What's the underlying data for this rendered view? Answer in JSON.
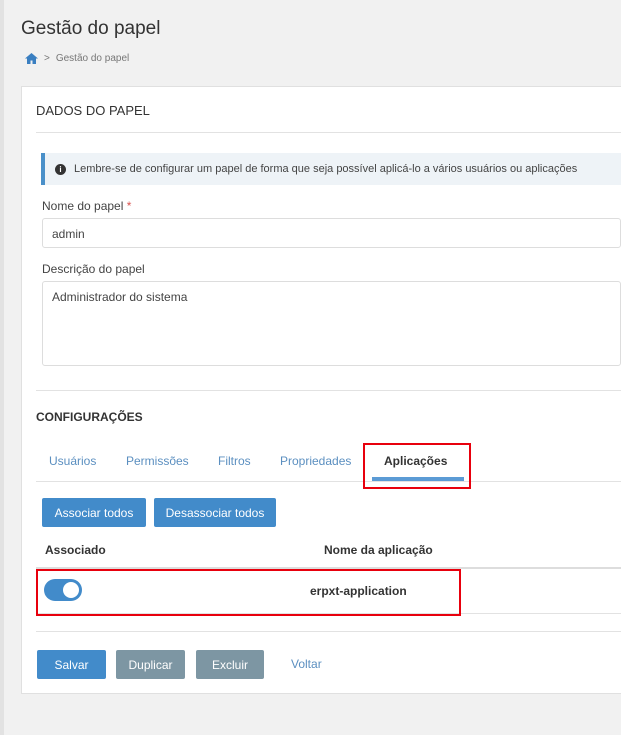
{
  "page": {
    "title": "Gestão do papel",
    "breadcrumb": [
      "Gestão do papel"
    ]
  },
  "card": {
    "section_title": "DADOS DO PAPEL",
    "info": "Lembre-se de configurar um papel de forma que seja possível aplicá-lo a vários usuários ou aplicações",
    "name_label": "Nome do papel",
    "required_mark": "*",
    "name_value": "admin",
    "desc_label": "Descrição do papel",
    "desc_value": "Administrador do sistema",
    "config_title": "CONFIGURAÇÕES",
    "tabs": [
      "Usuários",
      "Permissões",
      "Filtros",
      "Propriedades",
      "Aplicações"
    ],
    "active_tab": "Aplicações",
    "associate_all": "Associar todos",
    "disassociate_all": "Desassociar todos",
    "columns": [
      "Associado",
      "Nome da aplicação"
    ],
    "rows": [
      {
        "associated": true,
        "name": "erpxt-application"
      }
    ],
    "actions": {
      "save": "Salvar",
      "duplicate": "Duplicar",
      "delete": "Excluir",
      "back": "Voltar"
    }
  },
  "colors": {
    "primary": "#428bca",
    "secondary": "#7d96a3",
    "highlight": "#e8000d"
  }
}
